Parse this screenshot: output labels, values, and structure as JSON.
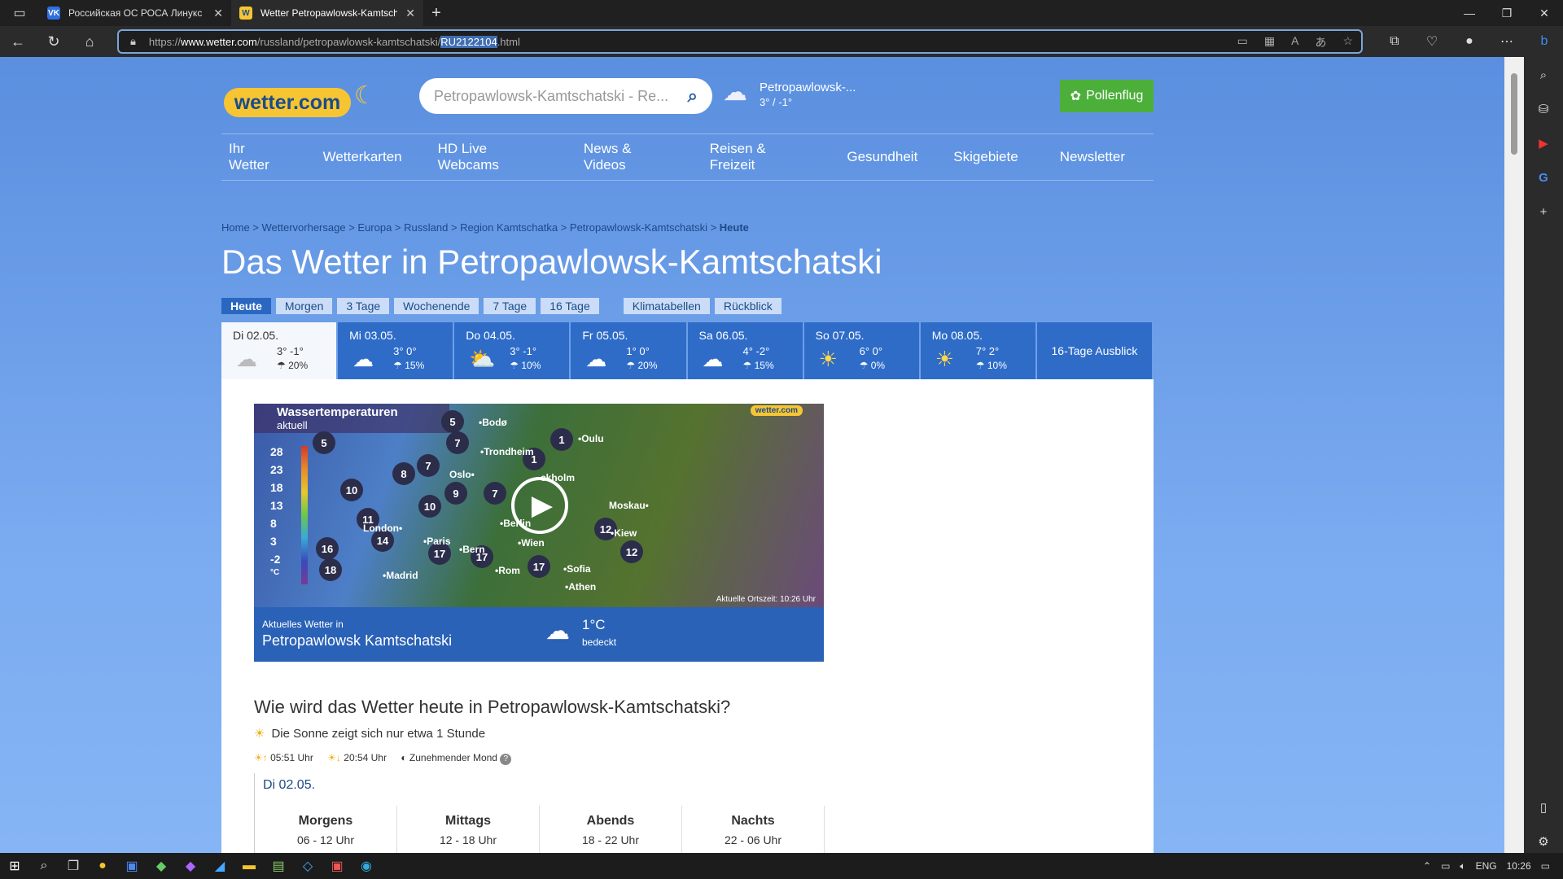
{
  "browser": {
    "tabs": [
      {
        "title": "Российская ОС РОСА Линукс | О",
        "favicon": "VK"
      },
      {
        "title": "Wetter Petropawlowsk-Kamtscha",
        "favicon": "W"
      }
    ],
    "url_prefix": "https://",
    "url_host": "www.wetter.com",
    "url_path": "/russland/petropawlowsk-kamtschatski/",
    "url_selected": "RU2122104",
    "url_suffix": ".html"
  },
  "site": {
    "logo_text": "wetter.com",
    "search_placeholder": "Petropawlowsk-Kamtschatski - Re...",
    "current_location": "Petropawlowsk-...",
    "current_temp": "3° / -1°",
    "pollen_label": "Pollenflug",
    "nav": [
      "Ihr Wetter",
      "Wetterkarten",
      "HD Live Webcams",
      "News & Videos",
      "Reisen & Freizeit",
      "Gesundheit",
      "Skigebiete",
      "Newsletter"
    ],
    "breadcrumb": "Home > Wettervorhersage > Europa > Russland > Region Kamtschatka > Petropawlowsk-Kamtschatski > ",
    "breadcrumb_current": "Heute",
    "title": "Das Wetter in Petropawlowsk-Kamtschatski",
    "tabs": [
      "Heute",
      "Morgen",
      "3 Tage",
      "Wochenende",
      "7 Tage",
      "16 Tage",
      "Klimatabellen",
      "Rückblick"
    ],
    "days": [
      {
        "date": "Di 02.05.",
        "temp": "3° -1°",
        "rain": "20%",
        "icon": "cloud-icon"
      },
      {
        "date": "Mi 03.05.",
        "temp": "3° 0°",
        "rain": "15%",
        "icon": "cloud-icon"
      },
      {
        "date": "Do 04.05.",
        "temp": "3° -1°",
        "rain": "10%",
        "icon": "partly-sunny-icon"
      },
      {
        "date": "Fr 05.05.",
        "temp": "1° 0°",
        "rain": "20%",
        "icon": "cloud-icon"
      },
      {
        "date": "Sa 06.05.",
        "temp": "4° -2°",
        "rain": "15%",
        "icon": "cloud-icon"
      },
      {
        "date": "So 07.05.",
        "temp": "6° 0°",
        "rain": "0%",
        "icon": "sun-icon"
      },
      {
        "date": "Mo 08.05.",
        "temp": "7° 2°",
        "rain": "10%",
        "icon": "sun-icon"
      }
    ],
    "outlook_label": "16-Tage Ausblick",
    "video": {
      "title": "Wassertemperaturen",
      "subtitle": "aktuell",
      "scale": [
        "28",
        "23",
        "18",
        "13",
        "8",
        "3",
        "-2",
        "°C"
      ],
      "logo": "wetter.com",
      "time_label": "Aktuelle Ortszeit: 10:26 Uhr",
      "caption_small": "Aktuelles Wetter in",
      "caption_city": "Petropawlowsk Kamtschatski",
      "caption_temp": "1°C",
      "caption_cond": "bedeckt"
    },
    "question": "Wie wird das Wetter heute in Petropawlowsk-Kamtschatski?",
    "sun_text": "Die Sonne zeigt sich nur etwa 1 Stunde",
    "sunrise": "05:51 Uhr",
    "sunset": "20:54 Uhr",
    "moon": "Zunehmender Mond",
    "day_header": "Di 02.05.",
    "periods": [
      {
        "name": "Morgens",
        "range": "06 - 12 Uhr"
      },
      {
        "name": "Mittags",
        "range": "12 - 18 Uhr"
      },
      {
        "name": "Abends",
        "range": "18 - 22 Uhr"
      },
      {
        "name": "Nachts",
        "range": "22 - 06 Uhr"
      }
    ]
  },
  "taskbar": {
    "lang": "ENG",
    "time": "10:26"
  }
}
